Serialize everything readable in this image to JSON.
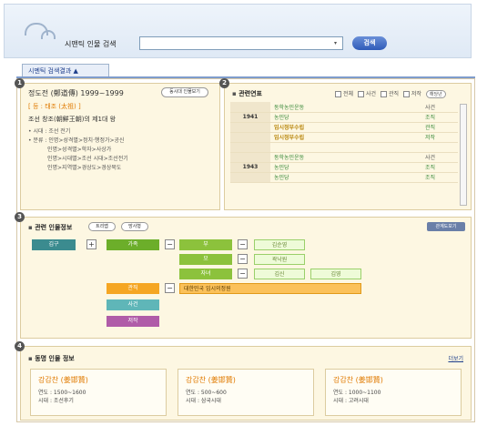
{
  "search": {
    "label": "시맨틱 인물 검색",
    "placeholder": "",
    "button": "검색",
    "dropdown": "▾"
  },
  "result_tab": "시멘틱 검색결과 ▲",
  "section1": {
    "number": "1",
    "title": "정도전 (鄭道傳) 1999~1999",
    "pill": "동시대 인물보기",
    "subtitle": "[ 등 : 태조 (太祖) ]",
    "desc": "조선 창조(朝鮮王朝)의 제1대 왕",
    "info": [
      "• 시대 : 조선 전기",
      "• 분류 : 인명>성격별>정치·행정가>공신",
      "           인명>성격별>학자>사상가",
      "           인명>시대별>조선 시대>조선전기",
      "           인명>지역별>경상도>경상북도"
    ]
  },
  "section2": {
    "number": "2",
    "heading": "관련연표",
    "filters": [
      "전체",
      "사건",
      "관직",
      "저작"
    ],
    "filter_button": "해당년",
    "rows": [
      {
        "year": "",
        "event": "동학농민운동",
        "category": "사건",
        "hl": false,
        "green": false
      },
      {
        "year": "1941",
        "event": "농민당",
        "category": "조직",
        "hl": false,
        "green": true
      },
      {
        "year": "",
        "event": "임시정부수립",
        "category": "관직",
        "hl": true,
        "green": true
      },
      {
        "year": "",
        "event": "임시정부수립",
        "category": "저작",
        "hl": true,
        "green": true
      },
      {
        "year": "",
        "event": "",
        "category": "",
        "hl": false,
        "green": false
      },
      {
        "year": "",
        "event": "동학농민운동",
        "category": "사건",
        "hl": false,
        "green": false
      },
      {
        "year": "1943",
        "event": "농민당",
        "category": "조직",
        "hl": false,
        "green": true
      },
      {
        "year": "",
        "event": "농민당",
        "category": "조직",
        "hl": false,
        "green": true
      }
    ]
  },
  "section3": {
    "number": "3",
    "heading": "관련 인물정보",
    "pill1": "트리맵",
    "pill2": "망사형",
    "big_button": "관계도보기",
    "self": "김구",
    "family": "가족",
    "father": "부",
    "mother": "모",
    "children": "자녀",
    "father_name": "김순영",
    "mother_name": "곽낙원",
    "child1": "김신",
    "child2": "김영",
    "office": "관직",
    "office_value": "대한민국 임시의정원",
    "event": "사건",
    "work": "저작",
    "plus": "+",
    "minus": "−"
  },
  "section4": {
    "number": "4",
    "heading": "동명 인물 정보",
    "more": "더보기",
    "cards": [
      {
        "name": "강감찬 (姜邯贊)",
        "year": "연도 : 1500~1600",
        "era": "시대 : 조선후기"
      },
      {
        "name": "강감찬 (姜邯贊)",
        "year": "연도 : 500~600",
        "era": "시대 : 삼국시대"
      },
      {
        "name": "강감찬 (姜邯贊)",
        "year": "연도 : 1000~1100",
        "era": "시대 : 고려시대"
      }
    ]
  },
  "colors": {
    "self_box": "#3b8b8f",
    "family_box": "#6cae2a",
    "office_box": "#f5a623",
    "event_box": "#5fb6b8",
    "work_box": "#b05ca8",
    "section_bg": "#fdf7e2"
  }
}
